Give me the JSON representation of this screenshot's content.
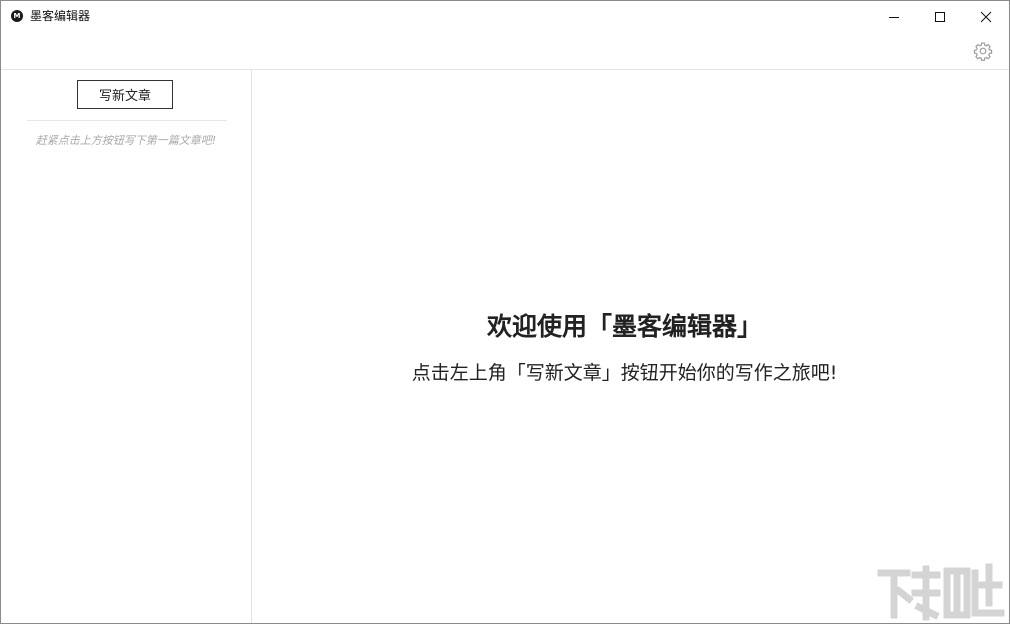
{
  "window": {
    "title": "墨客编辑器",
    "logo_letter": "M",
    "controls": {
      "minimize_icon": "minimize-icon",
      "maximize_icon": "maximize-icon",
      "close_icon": "close-icon"
    }
  },
  "toolbar": {
    "settings_icon": "gear-icon"
  },
  "sidebar": {
    "new_article_label": "写新文章",
    "empty_hint": "赶紧点击上方按钮写下第一篇文章吧!"
  },
  "main": {
    "welcome_title": "欢迎使用「墨客编辑器」",
    "welcome_subtitle": "点击左上角「写新文章」按钮开始你的写作之旅吧!"
  },
  "colors": {
    "border": "#e3e3e3",
    "hint_text": "#a8a8a8",
    "text": "#222222"
  }
}
